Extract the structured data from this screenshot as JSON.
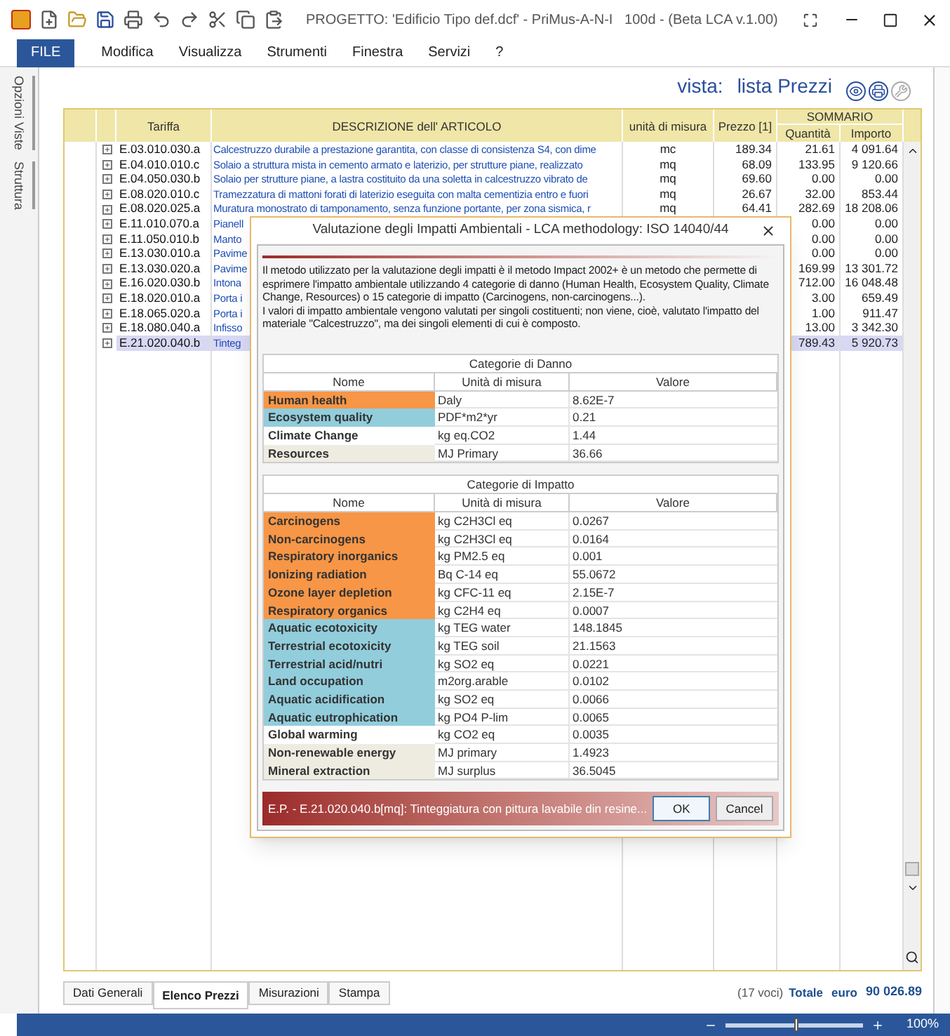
{
  "window": {
    "title": "PROGETTO: 'Edificio Tipo def.dcf' - PriMus-A-N-I   100d - (Beta LCA v.1.00)"
  },
  "menu": [
    {
      "label": "FILE",
      "kind": "file"
    },
    {
      "label": "Modifica",
      "kind": "menu"
    },
    {
      "label": "Visualizza",
      "kind": "menu"
    },
    {
      "label": "Strumenti",
      "kind": "menu"
    },
    {
      "label": "Finestra",
      "kind": "menu"
    },
    {
      "label": "Servizi",
      "kind": "menu"
    },
    {
      "label": "?",
      "kind": "menu"
    }
  ],
  "side_tabs": [
    "Opzioni Viste",
    "Struttura"
  ],
  "view": {
    "label": "vista:",
    "name": "lista Prezzi"
  },
  "table": {
    "columns": {
      "tariffa": "Tariffa",
      "descrizione": "DESCRIZIONE dell' ARTICOLO",
      "unita": "unità di misura",
      "prezzo": "Prezzo [1]",
      "sommario": "SOMMARIO",
      "quantita": "Quantità",
      "importo": "Importo"
    },
    "rows": [
      {
        "code": "E.03.010.030.a",
        "description": "Calcestruzzo durabile a prestazione garantita, con classe di consistenza S4, con dime",
        "unit": "mc",
        "price": "189.34",
        "quantity": "21.61",
        "amount": "4 091.64",
        "selected": false
      },
      {
        "code": "E.04.010.010.c",
        "description": "Solaio a struttura mista in cemento armato e laterizio, per strutture piane, realizzato",
        "unit": "mq",
        "price": "68.09",
        "quantity": "133.95",
        "amount": "9 120.66",
        "selected": false
      },
      {
        "code": "E.04.050.030.b",
        "description": "Solaio per strutture piane, a lastra costituito da una soletta in calcestruzzo vibrato de",
        "unit": "mq",
        "price": "69.60",
        "quantity": "0.00",
        "amount": "0.00",
        "selected": false
      },
      {
        "code": "E.08.020.010.c",
        "description": "Tramezzatura di mattoni forati di laterizio eseguita con malta cementizia entro e fuori",
        "unit": "mq",
        "price": "26.67",
        "quantity": "32.00",
        "amount": "853.44",
        "selected": false
      },
      {
        "code": "E.08.020.025.a",
        "description": "Muratura monostrato di tamponamento, senza funzione portante, per zona sismica, r",
        "unit": "mq",
        "price": "64.41",
        "quantity": "282.69",
        "amount": "18 208.06",
        "selected": false
      },
      {
        "code": "E.11.010.070.a",
        "description": "Pianell",
        "quantity": "0.00",
        "amount": "0.00",
        "selected": false
      },
      {
        "code": "E.11.050.010.b",
        "description": "Manto",
        "quantity": "0.00",
        "amount": "0.00",
        "selected": false
      },
      {
        "code": "E.13.030.010.a",
        "description": "Pavime",
        "quantity": "0.00",
        "amount": "0.00",
        "selected": false
      },
      {
        "code": "E.13.030.020.a",
        "description": "Pavime",
        "quantity": "169.99",
        "amount": "13 301.72",
        "selected": false
      },
      {
        "code": "E.16.020.030.b",
        "description": "Intona",
        "quantity": "712.00",
        "amount": "16 048.48",
        "selected": false
      },
      {
        "code": "E.18.020.010.a",
        "description": "Porta i",
        "quantity": "3.00",
        "amount": "659.49",
        "selected": false
      },
      {
        "code": "E.18.065.020.a",
        "description": "Porta i",
        "quantity": "1.00",
        "amount": "911.47",
        "selected": false
      },
      {
        "code": "E.18.080.040.a",
        "description": "Infisso",
        "quantity": "13.00",
        "amount": "3 342.30",
        "selected": false
      },
      {
        "code": "E.21.020.040.b",
        "description": "Tinteg",
        "quantity": "789.43",
        "amount": "5 920.73",
        "selected": true
      }
    ]
  },
  "bottom_tabs": [
    {
      "label": "Dati Generali",
      "selected": false
    },
    {
      "label": "Elenco Prezzi",
      "selected": true
    },
    {
      "label": "Misurazioni",
      "selected": false
    },
    {
      "label": "Stampa",
      "selected": false
    }
  ],
  "summary": {
    "count": "(17 voci)",
    "total_label": "Totale",
    "currency": "euro",
    "total": "90 026.89"
  },
  "status_bar": {
    "zoom": {
      "level": 0.5
    },
    "zoom_text": "100%"
  },
  "dialog": {
    "title": "Valutazione degli Impatti Ambientali - LCA methodology: ISO 14040/44",
    "intro": "Il metodo utilizzato per la valutazione degli impatti è il metodo Impact 2002+ è un metodo che permette di esprimere l'impatto ambientale utilizzando 4 categorie di danno (Human Health, Ecosystem Quality, Climate Change, Resources) o 15 categorie di impatto (Carcinogens, non-carcinogens...).\nI valori di impatto ambientale vengono valutati per singoli costituenti; non viene, cioè, valutato l'impatto del materiale \"Calcestruzzo\", ma dei singoli elementi di cui è composto.",
    "tables": [
      {
        "title": "Categorie di Danno",
        "columns": [
          "Nome",
          "Unità di misura",
          "Valore"
        ],
        "rows": [
          {
            "name": "Human health",
            "unit": "Daly",
            "value": "8.62E-7",
            "color": "#f79646"
          },
          {
            "name": "Ecosystem quality",
            "unit": "PDF*m2*yr",
            "value": "0.21",
            "color": "#92cddc"
          },
          {
            "name": "Climate Change",
            "unit": "kg eq.CO2",
            "value": "1.44",
            "color": "#ffffff"
          },
          {
            "name": "Resources",
            "unit": "MJ Primary",
            "value": "36.66",
            "color": "#eeece1"
          }
        ]
      },
      {
        "title": "Categorie di Impatto",
        "columns": [
          "Nome",
          "Unità di misura",
          "Valore"
        ],
        "rows": [
          {
            "name": "Carcinogens",
            "unit": "kg C2H3Cl eq",
            "value": "0.0267",
            "color": "#f79646"
          },
          {
            "name": "Non-carcinogens",
            "unit": "kg C2H3Cl eq",
            "value": "0.0164",
            "color": "#f79646"
          },
          {
            "name": "Respiratory inorganics",
            "unit": "kg PM2.5 eq",
            "value": "0.001",
            "color": "#f79646"
          },
          {
            "name": "Ionizing radiation",
            "unit": "Bq C-14 eq",
            "value": "55.0672",
            "color": "#f79646"
          },
          {
            "name": "Ozone layer depletion",
            "unit": "kg CFC-11 eq",
            "value": "2.15E-7",
            "color": "#f79646"
          },
          {
            "name": "Respiratory organics",
            "unit": "kg C2H4 eq",
            "value": "0.0007",
            "color": "#f79646"
          },
          {
            "name": "Aquatic ecotoxicity",
            "unit": "kg TEG water",
            "value": "148.1845",
            "color": "#92cddc"
          },
          {
            "name": "Terrestrial ecotoxicity",
            "unit": "kg TEG soil",
            "value": "21.1563",
            "color": "#92cddc"
          },
          {
            "name": "Terrestrial acid/nutri",
            "unit": "kg SO2 eq",
            "value": "0.0221",
            "color": "#92cddc"
          },
          {
            "name": "Land occupation",
            "unit": "m2org.arable",
            "value": "0.0102",
            "color": "#92cddc"
          },
          {
            "name": "Aquatic acidification",
            "unit": "kg SO2 eq",
            "value": "0.0066",
            "color": "#92cddc"
          },
          {
            "name": "Aquatic eutrophication",
            "unit": "kg PO4 P-lim",
            "value": "0.0065",
            "color": "#92cddc"
          },
          {
            "name": "Global warming",
            "unit": "kg CO2 eq",
            "value": "0.0035",
            "color": "#ffffff"
          },
          {
            "name": "Non-renewable energy",
            "unit": "MJ primary",
            "value": "1.4923",
            "color": "#eeece1"
          },
          {
            "name": "Mineral extraction",
            "unit": "MJ surplus",
            "value": "36.5045",
            "color": "#eeece1"
          }
        ]
      }
    ],
    "footer": "E.P. - E.21.020.040.b[mq]: Tinteggiatura con pittura lavabile din resine...",
    "buttons": [
      "OK",
      "Cancel"
    ]
  }
}
